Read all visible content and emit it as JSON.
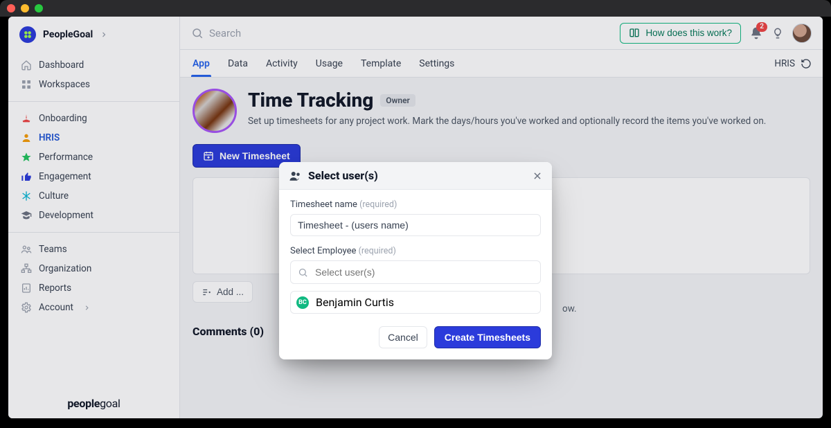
{
  "brand": {
    "name": "PeopleGoal"
  },
  "footer": {
    "brand_prefix": "people",
    "brand_suffix": "goal"
  },
  "sidebar": {
    "primary": [
      {
        "label": "Dashboard"
      },
      {
        "label": "Workspaces"
      }
    ],
    "apps": [
      {
        "label": "Onboarding",
        "icon_color": "#ef4444"
      },
      {
        "label": "HRIS",
        "icon_color": "#f59e0b",
        "active": true
      },
      {
        "label": "Performance",
        "icon_color": "#22c55e"
      },
      {
        "label": "Engagement",
        "icon_color": "#2b3bdb"
      },
      {
        "label": "Culture",
        "icon_color": "#06b6d4"
      },
      {
        "label": "Development",
        "icon_color": "#6b7280"
      }
    ],
    "admin": [
      {
        "label": "Teams"
      },
      {
        "label": "Organization"
      },
      {
        "label": "Reports"
      },
      {
        "label": "Account"
      }
    ]
  },
  "header": {
    "search_placeholder": "Search",
    "help_label": "How does this work?",
    "notification_count": "2"
  },
  "tabs": {
    "items": [
      {
        "label": "App",
        "active": true
      },
      {
        "label": "Data"
      },
      {
        "label": "Activity"
      },
      {
        "label": "Usage"
      },
      {
        "label": "Template"
      },
      {
        "label": "Settings"
      }
    ],
    "right_label": "HRIS"
  },
  "page": {
    "title": "Time Tracking",
    "badge": "Owner",
    "description": "Set up timesheets for any project work. Mark the days/hours you've worked and optionally record the items you've worked on.",
    "new_button": "New Timesheet",
    "add_button": "Add ...",
    "comments_label": "Comments (0)",
    "desc_tail": "ow."
  },
  "modal": {
    "title": "Select user(s)",
    "name_label": "Timesheet name",
    "required": "(required)",
    "name_value": "Timesheet - (users name)",
    "employee_label": "Select Employee",
    "employee_placeholder": "Select user(s)",
    "selected_user": {
      "name": "Benjamin Curtis",
      "initials": "BC"
    },
    "cancel": "Cancel",
    "submit": "Create Timesheets"
  }
}
